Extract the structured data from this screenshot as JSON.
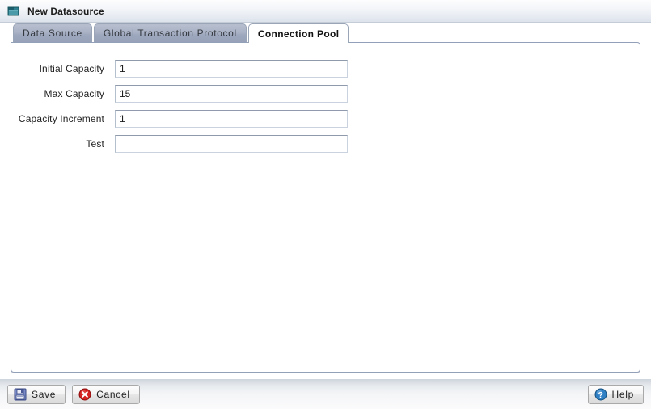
{
  "window": {
    "title": "New Datasource",
    "title_icon": "folder-icon"
  },
  "tabs": [
    {
      "label": "Data Source",
      "active": false
    },
    {
      "label": "Global Transaction Protocol",
      "active": false
    },
    {
      "label": "Connection Pool",
      "active": true
    }
  ],
  "form": {
    "fields": [
      {
        "label": "Initial Capacity",
        "value": "1",
        "placeholder": ""
      },
      {
        "label": "Max Capacity",
        "value": "15",
        "placeholder": ""
      },
      {
        "label": "Capacity Increment",
        "value": "1",
        "placeholder": ""
      },
      {
        "label": "Test",
        "value": "",
        "placeholder": ""
      }
    ]
  },
  "buttonbar": {
    "save": {
      "label": "Save",
      "icon": "floppy-disk-icon"
    },
    "cancel": {
      "label": "Cancel",
      "icon": "error-circle-icon"
    },
    "help": {
      "label": "Help",
      "icon": "question-circle-icon"
    }
  },
  "colors": {
    "tab_active_bg": "#ffffff",
    "tab_inactive_bg": "#a6b0c3",
    "panel_border": "#93a1b8",
    "folder_icon": "#2d7e8e",
    "cancel_icon": "#cc1f1f",
    "help_icon": "#2f7fc4",
    "save_icon": "#6f7fc0"
  }
}
